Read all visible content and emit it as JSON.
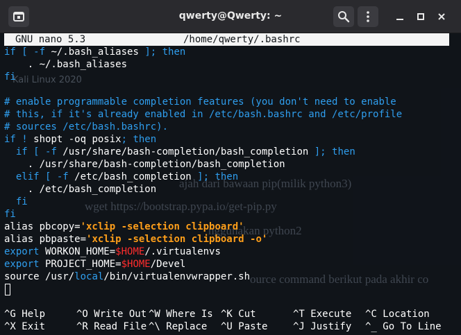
{
  "window": {
    "title": "qwerty@Qwerty: ~",
    "new_tab_icon": "new-tab-icon",
    "search_icon": "search-icon",
    "menu_icon": "kebab-menu-icon",
    "minimize_icon": "minimize-icon",
    "maximize_icon": "maximize-icon",
    "close_icon": "close-icon"
  },
  "nano": {
    "version": "GNU nano 5.3",
    "file": "/home/qwerty/.bashrc"
  },
  "background": {
    "watermark": "Kali Linux 2020",
    "doc_lines": [
      "ajah dari bawaan pip(milik python3)",
      "wget https://bootstrap.pypa.io/get-pip.py",
      "nggunakan python2",
      "ource command berikut pada akhir co"
    ]
  },
  "code": [
    [
      {
        "t": "if [ ",
        "c": "keyword"
      },
      {
        "t": "-f",
        "c": "keyword"
      },
      {
        "t": " ~/.bash_aliases ",
        "c": "plain"
      },
      {
        "t": "]; then",
        "c": "keyword"
      }
    ],
    [
      {
        "t": "    . ~/.bash_aliases",
        "c": "plain"
      }
    ],
    [
      {
        "t": "fi",
        "c": "keyword"
      }
    ],
    [
      {
        "t": "",
        "c": "plain"
      }
    ],
    [
      {
        "t": "# enable programmable completion features (you don't need to enable",
        "c": "comment"
      }
    ],
    [
      {
        "t": "# this, if it's already enabled in /etc/bash.bashrc and /etc/profile",
        "c": "comment"
      }
    ],
    [
      {
        "t": "# sources /etc/bash.bashrc).",
        "c": "comment"
      }
    ],
    [
      {
        "t": "if ! ",
        "c": "keyword"
      },
      {
        "t": "shopt -oq posix",
        "c": "plain"
      },
      {
        "t": "; then",
        "c": "keyword"
      }
    ],
    [
      {
        "t": "  if [ ",
        "c": "keyword"
      },
      {
        "t": "-f",
        "c": "keyword"
      },
      {
        "t": " /usr/share/bash-completion/bash_completion ",
        "c": "plain"
      },
      {
        "t": "]; then",
        "c": "keyword"
      }
    ],
    [
      {
        "t": "    . /usr/share/bash-completion/bash_completion",
        "c": "plain"
      }
    ],
    [
      {
        "t": "  elif [ ",
        "c": "keyword"
      },
      {
        "t": "-f",
        "c": "keyword"
      },
      {
        "t": " /etc/bash_completion ",
        "c": "plain"
      },
      {
        "t": "]; then",
        "c": "keyword"
      }
    ],
    [
      {
        "t": "    . /etc/bash_completion",
        "c": "plain"
      }
    ],
    [
      {
        "t": "  fi",
        "c": "keyword"
      }
    ],
    [
      {
        "t": "fi",
        "c": "keyword"
      }
    ],
    [
      {
        "t": "alias pbcopy=",
        "c": "plain"
      },
      {
        "t": "'xclip -selection clipboard'",
        "c": "string"
      }
    ],
    [
      {
        "t": "alias pbpaste=",
        "c": "plain"
      },
      {
        "t": "'xclip -selection clipboard -o'",
        "c": "string"
      }
    ],
    [
      {
        "t": "export",
        "c": "export"
      },
      {
        "t": " WORKON_HOME=",
        "c": "plain"
      },
      {
        "t": "$HOME",
        "c": "var"
      },
      {
        "t": "/.virtualenvs",
        "c": "plain"
      }
    ],
    [
      {
        "t": "export",
        "c": "export"
      },
      {
        "t": " PROJECT_HOME=",
        "c": "plain"
      },
      {
        "t": "$HOME",
        "c": "var"
      },
      {
        "t": "/Devel",
        "c": "plain"
      }
    ],
    [
      {
        "t": "source /usr/",
        "c": "plain"
      },
      {
        "t": "local",
        "c": "keyword"
      },
      {
        "t": "/bin/virtualenvwrapper.sh",
        "c": "plain"
      }
    ]
  ],
  "shortcuts": [
    [
      {
        "key": "^G",
        "label": "Help"
      },
      {
        "key": "^O",
        "label": "Write Out"
      },
      {
        "key": "^W",
        "label": "Where Is"
      },
      {
        "key": "^K",
        "label": "Cut"
      },
      {
        "key": "^T",
        "label": "Execute"
      },
      {
        "key": "^C",
        "label": "Location"
      }
    ],
    [
      {
        "key": "^X",
        "label": "Exit"
      },
      {
        "key": "^R",
        "label": "Read File"
      },
      {
        "key": "^\\",
        "label": "Replace"
      },
      {
        "key": "^U",
        "label": "Paste"
      },
      {
        "key": "^J",
        "label": "Justify"
      },
      {
        "key": "^_",
        "label": "Go To Line"
      }
    ]
  ],
  "colors": {
    "comment": "#2f9eee",
    "keyword": "#2f9eee",
    "string": "#ff9f1a",
    "variable": "#ff2d2d",
    "text": "#ffffff",
    "header_bg": "#f4f4f4"
  }
}
